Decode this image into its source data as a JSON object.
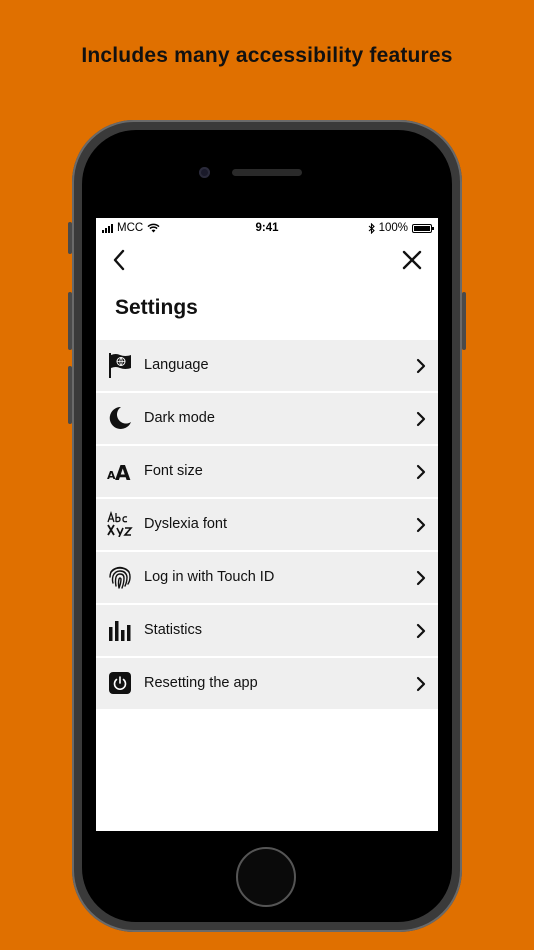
{
  "headline": "Includes many accessibility features",
  "status_bar": {
    "carrier": "MCC",
    "time": "9:41",
    "battery": "100%"
  },
  "screen": {
    "title": "Settings",
    "back_icon": "chevron-left-icon",
    "close_icon": "close-icon"
  },
  "settings_items": [
    {
      "label": "Language",
      "icon": "flag-globe-icon"
    },
    {
      "label": "Dark mode",
      "icon": "moon-icon"
    },
    {
      "label": "Font size",
      "icon": "font-size-icon"
    },
    {
      "label": "Dyslexia font",
      "icon": "dyslexia-font-icon"
    },
    {
      "label": "Log in with Touch ID",
      "icon": "fingerprint-icon"
    },
    {
      "label": "Statistics",
      "icon": "bar-chart-icon"
    },
    {
      "label": "Resetting the app",
      "icon": "power-icon"
    }
  ],
  "colors": {
    "background": "#e07000",
    "row_background": "#efefef",
    "text": "#111111"
  }
}
